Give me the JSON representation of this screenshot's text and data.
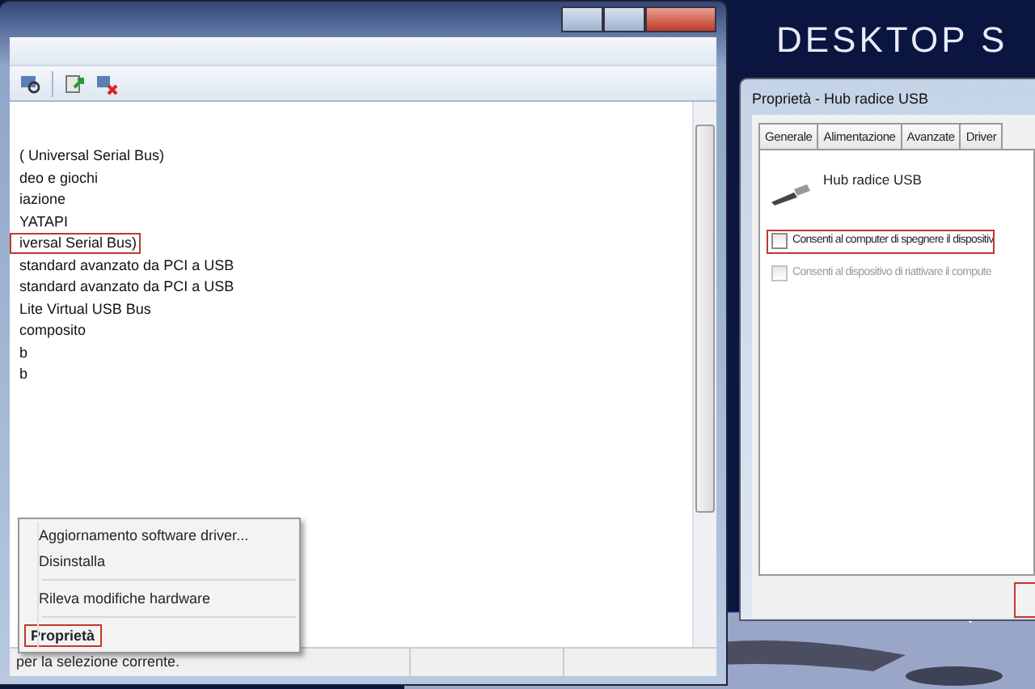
{
  "wallpaper_text": "DESKTOP S",
  "device_manager": {
    "tree_items": [
      {
        "label": "( Universal Serial Bus)",
        "highlighted": false
      },
      {
        "label": "deo e giochi",
        "highlighted": false
      },
      {
        "label": "iazione",
        "highlighted": false
      },
      {
        "label": "YATAPI",
        "highlighted": false
      },
      {
        "label": "iversal Serial Bus)",
        "highlighted": true
      },
      {
        "label": "standard avanzato da PCI a USB",
        "highlighted": false
      },
      {
        "label": "standard avanzato da PCI a USB",
        "highlighted": false
      },
      {
        "label": "Lite Virtual USB Bus",
        "highlighted": false
      },
      {
        "label": "composito",
        "highlighted": false
      },
      {
        "label": "b",
        "highlighted": false
      },
      {
        "label": "b",
        "highlighted": false
      }
    ],
    "context_menu": [
      {
        "kind": "item",
        "label": "Aggiornamento software driver...",
        "highlighted": false
      },
      {
        "kind": "item",
        "label": "Disinstalla",
        "highlighted": false
      },
      {
        "kind": "separator"
      },
      {
        "kind": "item",
        "label": "Rileva modifiche hardware",
        "highlighted": false
      },
      {
        "kind": "separator"
      },
      {
        "kind": "item",
        "label": "Proprietà",
        "highlighted": true
      }
    ],
    "status_bar": "per la selezione corrente."
  },
  "properties_dialog": {
    "title": "Proprietà - Hub radice USB",
    "tabs": [
      {
        "label": "Generale",
        "selected": false
      },
      {
        "label": "Alimentazione",
        "selected": false
      },
      {
        "label": "Avanzate",
        "selected": false
      },
      {
        "label": "Driver",
        "selected": false
      }
    ],
    "device_name": "Hub radice USB",
    "options": [
      {
        "label": "Consenti al computer di spegnere il dispositiv",
        "checked": false,
        "disabled": false,
        "highlighted": true
      },
      {
        "label": "Consenti al dispositivo di riattivare il compute",
        "checked": false,
        "disabled": true,
        "highlighted": false
      }
    ]
  }
}
